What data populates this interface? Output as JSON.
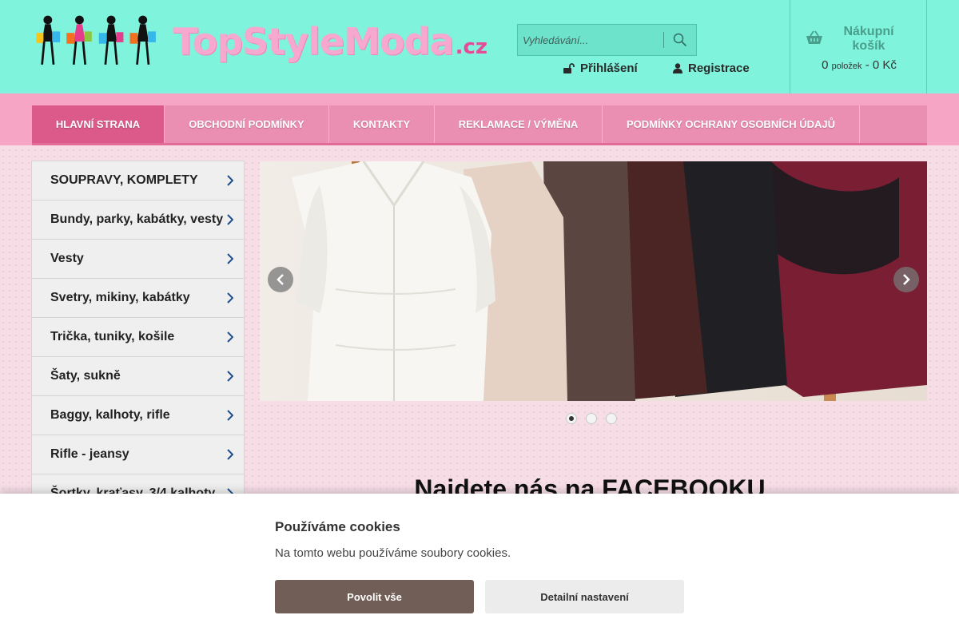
{
  "header": {
    "logo_text": "TopStyleModa",
    "logo_tld": ".cz",
    "search": {
      "placeholder": "Vyhledávání..."
    },
    "login_label": "Přihlášení",
    "register_label": "Registrace",
    "cart": {
      "title": "Nákupní košík",
      "count": "0",
      "count_unit": "položek",
      "separator": "-",
      "total": "0 Kč"
    }
  },
  "nav": {
    "items": [
      {
        "label": "HLAVNÍ STRANA",
        "active": true
      },
      {
        "label": "OBCHODNÍ PODMÍNKY"
      },
      {
        "label": "KONTAKTY"
      },
      {
        "label": "REKLAMACE / VÝMĚNA"
      },
      {
        "label": "PODMÍNKY OCHRANY OSOBNÍCH ÚDAJŮ"
      }
    ]
  },
  "sidebar": {
    "categories": [
      "SOUPRAVY, KOMPLETY",
      "Bundy, parky, kabátky, vesty",
      "Vesty",
      "Svetry, mikiny, kabátky",
      "Trička, tuniky, košile",
      "Šaty, sukně",
      "Baggy, kalhoty, rifle",
      "Rifle - jeansy",
      "Šortky, kraťasy, 3/4 kalhoty"
    ]
  },
  "slider": {
    "slide_count": 3,
    "active_index": 0
  },
  "main": {
    "facebook_heading": "Najdete nás na FACEBOOKU"
  },
  "cookies": {
    "title": "Používáme cookies",
    "text": "Na tomto webu používáme soubory cookies.",
    "allow_label": "Povolit vše",
    "detail_label": "Detailní nastavení"
  },
  "colors": {
    "header_bg": "#7ff3dc",
    "nav_bg": "#eb8fb2",
    "nav_active": "#dc5a8a",
    "logo_pink": "#f6a8cf",
    "allow_button": "#715f57"
  }
}
